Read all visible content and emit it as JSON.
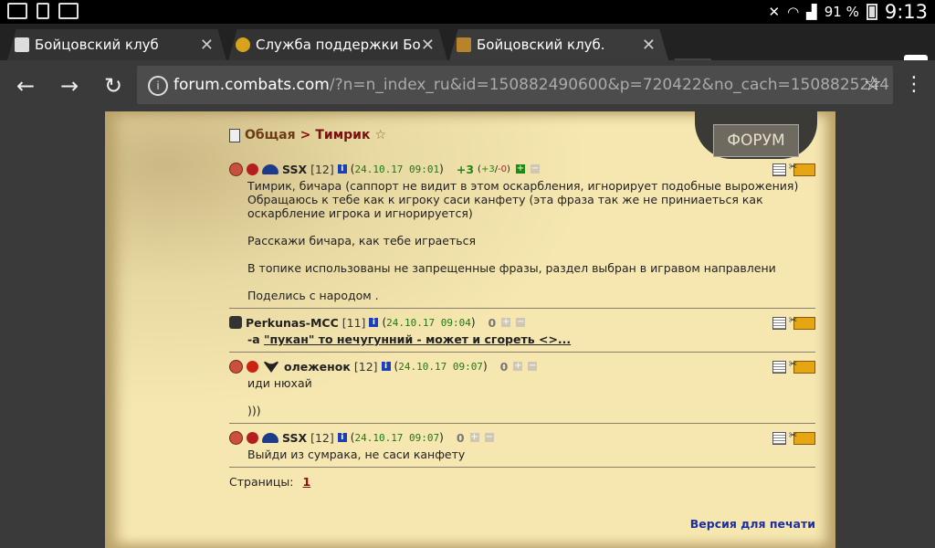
{
  "status_bar": {
    "battery": "91 %",
    "time": "9:13"
  },
  "tabs": [
    {
      "title": "Бойцовский клуб",
      "active": false
    },
    {
      "title": "Служба поддержки Бойцовс",
      "active": false
    },
    {
      "title": "Бойцовский клуб.",
      "active": true
    }
  ],
  "address_bar": {
    "host": "forum.combats.com",
    "path": "/?n=n_index_ru&id=150882490600&p=720422&no_cach=1508825244"
  },
  "forum": {
    "logo_text": "ФОРУМ",
    "breadcrumb": {
      "section": "Общая",
      "separator": ">",
      "topic": "Тимрик",
      "star": "☆"
    },
    "posts": [
      {
        "nick": "SSX",
        "level": "[12]",
        "date": "24.10.17 09:01",
        "rating": "+3",
        "votes_plus": "+3",
        "votes_minus": "-0",
        "body": "Тимрик, бичара (саппорт не видит в этом оскарбления, игнорирует подобные вырожения)\nОбращаюсь к тебе как к игроку саси канфету (эта фраза так же не приниаеться как оскарбление игрока и игнорируется)\n\nРасскажи бичара, как тебе играеться\n\nВ топике использованы не запрещенные фразы, раздел выбран в игравом направлени\n\nПоделись с народом ."
      },
      {
        "nick": "Perkunas-MCC",
        "level": "[11]",
        "date": "24.10.17 09:04",
        "rating": "0",
        "body_prefix": "-а ",
        "body_link": "\"пукан\" то нечугунний - может и сгореть <>..."
      },
      {
        "nick": "олеженок",
        "level": "[12]",
        "date": "24.10.17 09:07",
        "rating": "0",
        "body": "иди нюхай\n\n)))"
      },
      {
        "nick": "SSX",
        "level": "[12]",
        "date": "24.10.17 09:07",
        "rating": "0",
        "body": "Выйди из сумрака, не саси канфету"
      }
    ],
    "pages_label": "Страницы:",
    "page_current": "1",
    "print_version": "Версия для печати"
  }
}
